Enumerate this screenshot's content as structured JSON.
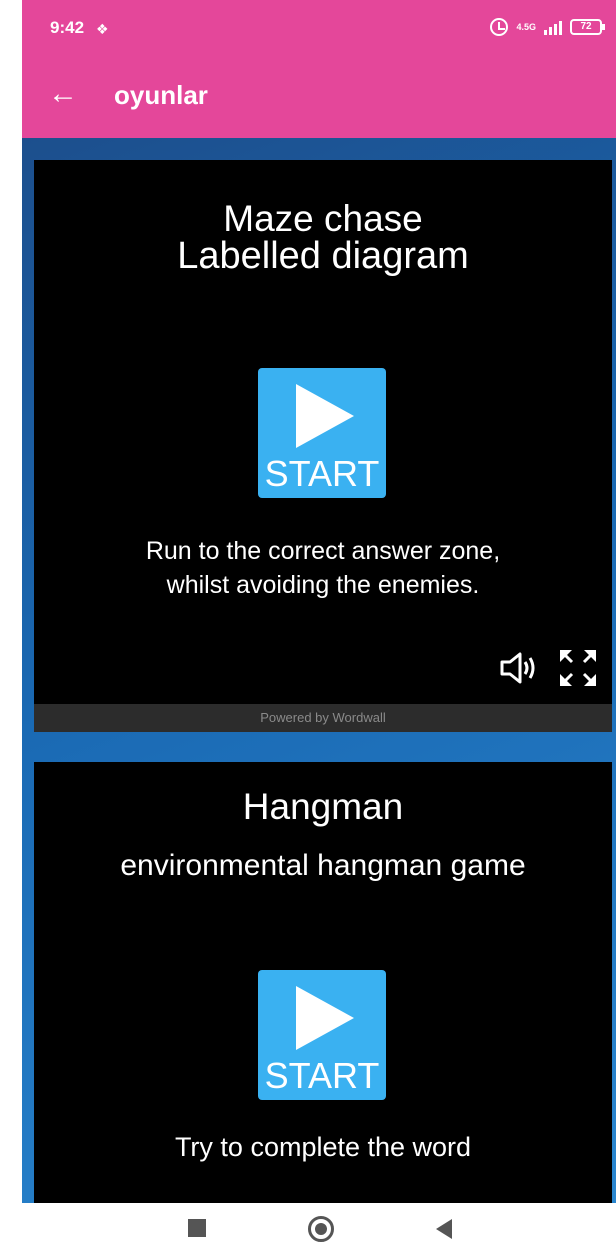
{
  "status_bar": {
    "time": "9:42",
    "app_icon": "layers-icon",
    "network_type": "4.5G",
    "battery_level": "72"
  },
  "app_bar": {
    "back_icon": "arrow-left-icon",
    "title": "oyunlar"
  },
  "games": [
    {
      "type": "Maze chase",
      "title": "Labelled diagram",
      "start_label": "START",
      "description": "Run to the correct answer zone, whilst avoiding the enemies.",
      "sound_icon": "speaker-icon",
      "fullscreen_icon": "fullscreen-icon",
      "powered_by": "Powered by Wordwall"
    },
    {
      "type": "Hangman",
      "title": "environmental hangman game",
      "start_label": "START",
      "description": "Try to complete the word"
    }
  ],
  "nav_bar": {
    "recents_icon": "square-icon",
    "home_icon": "circle-icon",
    "back_icon": "triangle-back-icon"
  },
  "colors": {
    "accent": "#e4479a",
    "start_button": "#3ab1f1",
    "card_background": "#000000"
  }
}
